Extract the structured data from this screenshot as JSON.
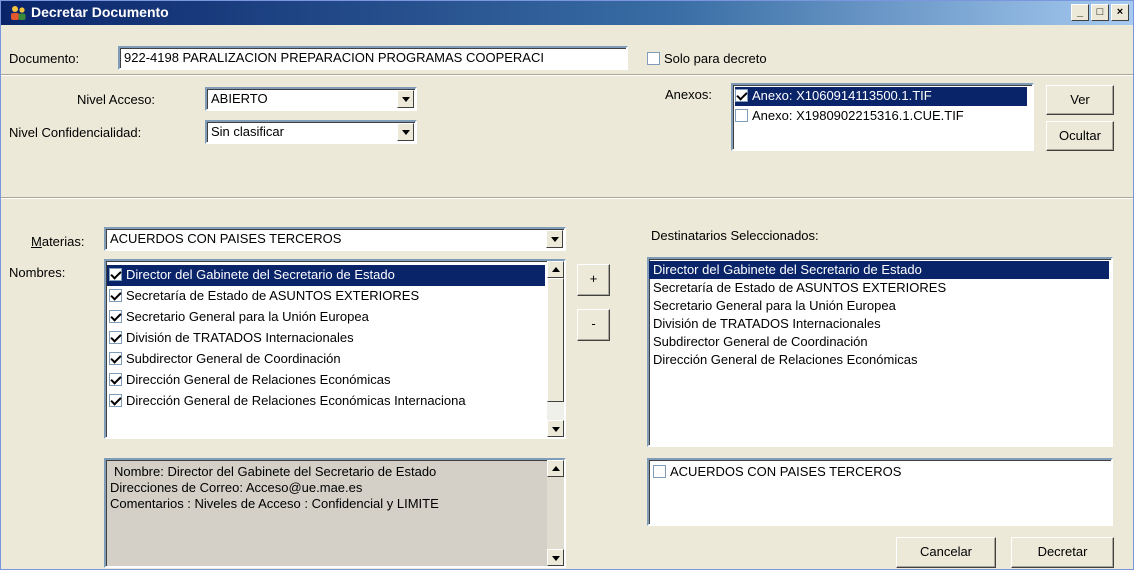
{
  "window": {
    "title": "Decretar Documento",
    "controls": {
      "minimize": "_",
      "maximize": "□",
      "close": "×"
    }
  },
  "documento": {
    "label": "Documento:",
    "value": "922-4198 PARALIZACION PREPARACION PROGRAMAS COOPERACI"
  },
  "solo_decreto": {
    "label": "Solo para decreto",
    "checked": false
  },
  "nivel_acceso": {
    "label": "Nivel Acceso:",
    "value": "ABIERTO"
  },
  "nivel_confidencialidad": {
    "label": "Nivel Confidencialidad:",
    "value": "Sin clasificar"
  },
  "anexos": {
    "label": "Anexos:",
    "items": [
      {
        "label": "Anexo: X1060914113500.1.TIF",
        "checked": true,
        "selected": true
      },
      {
        "label": "Anexo: X1980902215316.1.CUE.TIF",
        "checked": false,
        "selected": false
      }
    ],
    "ver_button": "Ver",
    "ocultar_button": "Ocultar"
  },
  "materias": {
    "label_first": "M",
    "label_rest": "aterias:",
    "value": "ACUERDOS CON PAISES TERCEROS"
  },
  "nombres": {
    "label": "Nombres:",
    "items": [
      {
        "label": "Director del Gabinete del Secretario de Estado",
        "checked": true,
        "selected": true
      },
      {
        "label": "Secretaría de Estado de ASUNTOS EXTERIORES",
        "checked": true,
        "selected": false
      },
      {
        "label": "Secretario General para la Unión Europea",
        "checked": true,
        "selected": false
      },
      {
        "label": "División de TRATADOS Internacionales",
        "checked": true,
        "selected": false
      },
      {
        "label": "Subdirector General de Coordinación",
        "checked": true,
        "selected": false
      },
      {
        "label": "Dirección General de Relaciones Económicas",
        "checked": true,
        "selected": false
      },
      {
        "label": "Dirección General de Relaciones Económicas Internaciona",
        "checked": true,
        "selected": false
      }
    ]
  },
  "add_button": "+",
  "remove_button": "-",
  "detalle": {
    "line1": "Nombre: Director del Gabinete del Secretario de Estado",
    "line2": "Direcciones de Correo:  Acceso@ue.mae.es",
    "line3": "Comentarios : Niveles de Acceso : Confidencial y LIMITE"
  },
  "destinatarios": {
    "label": "Destinatarios Seleccionados:",
    "items": [
      {
        "label": "Director del Gabinete del Secretario de Estado",
        "selected": true
      },
      {
        "label": "Secretaría de Estado de ASUNTOS EXTERIORES",
        "selected": false
      },
      {
        "label": "Secretario General para la Unión Europea",
        "selected": false
      },
      {
        "label": "División de TRATADOS Internacionales",
        "selected": false
      },
      {
        "label": "Subdirector General de Coordinación",
        "selected": false
      },
      {
        "label": "Dirección General de Relaciones Económicas",
        "selected": false
      }
    ]
  },
  "materias_list": {
    "items": [
      {
        "label": "ACUERDOS CON PAISES TERCEROS",
        "checked": false
      }
    ]
  },
  "cancelar_button": "Cancelar",
  "decretar_button": "Decretar",
  "colors": {
    "title_bar": "#0a246a",
    "selection": "#0a246a",
    "face": "#ece9d8"
  }
}
